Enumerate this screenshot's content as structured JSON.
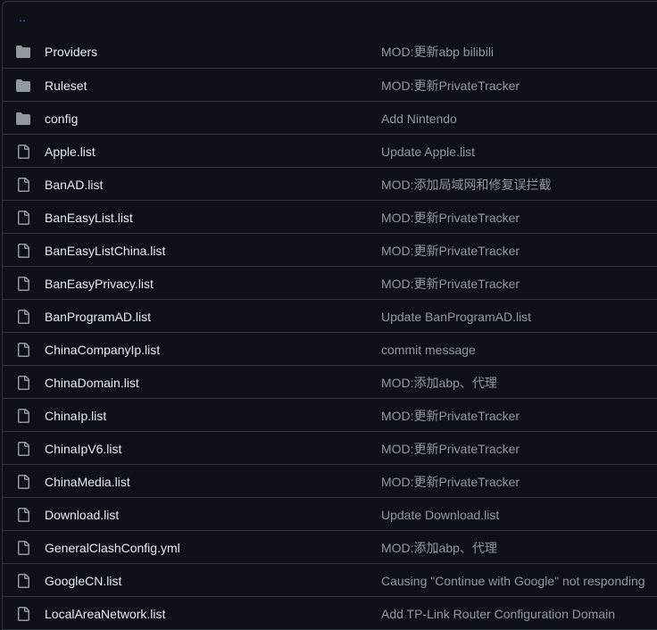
{
  "parent_directory": {
    "label": "..",
    "color": "#2f81f7"
  },
  "colors": {
    "background": "#0d1117",
    "border": "#30363d",
    "text": "#e6edf3",
    "muted": "#9198a1",
    "folder_icon": "#9198a1"
  },
  "rows": [
    {
      "type": "dir",
      "icon": "folder-icon",
      "name": "Providers",
      "commit": "MOD:更新abp bilibili"
    },
    {
      "type": "dir",
      "icon": "folder-icon",
      "name": "Ruleset",
      "commit": "MOD:更新PrivateTracker"
    },
    {
      "type": "dir",
      "icon": "folder-icon",
      "name": "config",
      "commit": "Add Nintendo"
    },
    {
      "type": "file",
      "icon": "file-icon",
      "name": "Apple.list",
      "commit": "Update Apple.list"
    },
    {
      "type": "file",
      "icon": "file-icon",
      "name": "BanAD.list",
      "commit": "MOD:添加局域网和修复误拦截"
    },
    {
      "type": "file",
      "icon": "file-icon",
      "name": "BanEasyList.list",
      "commit": "MOD:更新PrivateTracker"
    },
    {
      "type": "file",
      "icon": "file-icon",
      "name": "BanEasyListChina.list",
      "commit": "MOD:更新PrivateTracker"
    },
    {
      "type": "file",
      "icon": "file-icon",
      "name": "BanEasyPrivacy.list",
      "commit": "MOD:更新PrivateTracker"
    },
    {
      "type": "file",
      "icon": "file-icon",
      "name": "BanProgramAD.list",
      "commit": "Update BanProgramAD.list"
    },
    {
      "type": "file",
      "icon": "file-icon",
      "name": "ChinaCompanyIp.list",
      "commit": "commit message"
    },
    {
      "type": "file",
      "icon": "file-icon",
      "name": "ChinaDomain.list",
      "commit": "MOD:添加abp、代理"
    },
    {
      "type": "file",
      "icon": "file-icon",
      "name": "ChinaIp.list",
      "commit": "MOD:更新PrivateTracker"
    },
    {
      "type": "file",
      "icon": "file-icon",
      "name": "ChinaIpV6.list",
      "commit": "MOD:更新PrivateTracker"
    },
    {
      "type": "file",
      "icon": "file-icon",
      "name": "ChinaMedia.list",
      "commit": "MOD:更新PrivateTracker"
    },
    {
      "type": "file",
      "icon": "file-icon",
      "name": "Download.list",
      "commit": "Update Download.list"
    },
    {
      "type": "file",
      "icon": "file-icon",
      "name": "GeneralClashConfig.yml",
      "commit": "MOD:添加abp、代理"
    },
    {
      "type": "file",
      "icon": "file-icon",
      "name": "GoogleCN.list",
      "commit": "Causing \"Continue with Google\" not responding"
    },
    {
      "type": "file",
      "icon": "file-icon",
      "name": "LocalAreaNetwork.list",
      "commit": "Add TP-Link Router Configuration Domain"
    }
  ]
}
